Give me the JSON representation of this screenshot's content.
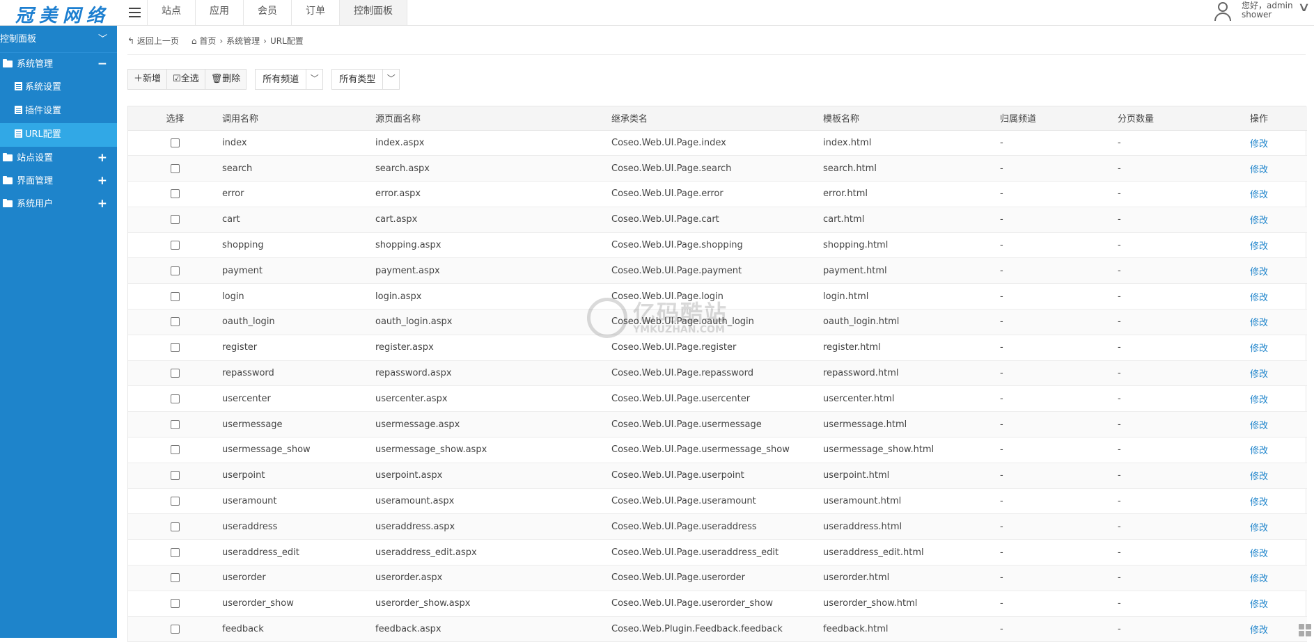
{
  "header": {
    "logo_text": "冠美网络",
    "nav": [
      "站点",
      "应用",
      "会员",
      "订单",
      "控制面板"
    ],
    "active_nav": "控制面板",
    "greeting": "您好，admin",
    "username": "shower"
  },
  "sidebar": {
    "title": "控制面板",
    "groups": [
      {
        "label": "系统管理",
        "toggle": "−",
        "items": [
          "系统设置",
          "插件设置",
          "URL配置"
        ]
      },
      {
        "label": "站点设置",
        "toggle": "+"
      },
      {
        "label": "界面管理",
        "toggle": "+"
      },
      {
        "label": "系统用户",
        "toggle": "+"
      }
    ],
    "active_item": "URL配置"
  },
  "breadcrumb": {
    "back": "返回上一页",
    "home": "首页",
    "level1": "系统管理",
    "current": "URL配置"
  },
  "toolbar": {
    "add_label": "新增",
    "select_all_label": "全选",
    "delete_label": "删除",
    "channel_select": "所有频道",
    "type_select": "所有类型"
  },
  "table": {
    "headers": [
      "选择",
      "调用名称",
      "源页面名称",
      "继承类名",
      "模板名称",
      "归属频道",
      "分页数量",
      "操作"
    ],
    "rows": [
      [
        "index",
        "index.aspx",
        "Coseo.Web.UI.Page.index",
        "index.html",
        "-",
        "-",
        "修改"
      ],
      [
        "search",
        "search.aspx",
        "Coseo.Web.UI.Page.search",
        "search.html",
        "-",
        "-",
        "修改"
      ],
      [
        "error",
        "error.aspx",
        "Coseo.Web.UI.Page.error",
        "error.html",
        "-",
        "-",
        "修改"
      ],
      [
        "cart",
        "cart.aspx",
        "Coseo.Web.UI.Page.cart",
        "cart.html",
        "-",
        "-",
        "修改"
      ],
      [
        "shopping",
        "shopping.aspx",
        "Coseo.Web.UI.Page.shopping",
        "shopping.html",
        "-",
        "-",
        "修改"
      ],
      [
        "payment",
        "payment.aspx",
        "Coseo.Web.UI.Page.payment",
        "payment.html",
        "-",
        "-",
        "修改"
      ],
      [
        "login",
        "login.aspx",
        "Coseo.Web.UI.Page.login",
        "login.html",
        "-",
        "-",
        "修改"
      ],
      [
        "oauth_login",
        "oauth_login.aspx",
        "Coseo.Web.UI.Page.oauth_login",
        "oauth_login.html",
        "-",
        "-",
        "修改"
      ],
      [
        "register",
        "register.aspx",
        "Coseo.Web.UI.Page.register",
        "register.html",
        "-",
        "-",
        "修改"
      ],
      [
        "repassword",
        "repassword.aspx",
        "Coseo.Web.UI.Page.repassword",
        "repassword.html",
        "-",
        "-",
        "修改"
      ],
      [
        "usercenter",
        "usercenter.aspx",
        "Coseo.Web.UI.Page.usercenter",
        "usercenter.html",
        "-",
        "-",
        "修改"
      ],
      [
        "usermessage",
        "usermessage.aspx",
        "Coseo.Web.UI.Page.usermessage",
        "usermessage.html",
        "-",
        "-",
        "修改"
      ],
      [
        "usermessage_show",
        "usermessage_show.aspx",
        "Coseo.Web.UI.Page.usermessage_show",
        "usermessage_show.html",
        "-",
        "-",
        "修改"
      ],
      [
        "userpoint",
        "userpoint.aspx",
        "Coseo.Web.UI.Page.userpoint",
        "userpoint.html",
        "-",
        "-",
        "修改"
      ],
      [
        "useramount",
        "useramount.aspx",
        "Coseo.Web.UI.Page.useramount",
        "useramount.html",
        "-",
        "-",
        "修改"
      ],
      [
        "useraddress",
        "useraddress.aspx",
        "Coseo.Web.UI.Page.useraddress",
        "useraddress.html",
        "-",
        "-",
        "修改"
      ],
      [
        "useraddress_edit",
        "useraddress_edit.aspx",
        "Coseo.Web.UI.Page.useraddress_edit",
        "useraddress_edit.html",
        "-",
        "-",
        "修改"
      ],
      [
        "userorder",
        "userorder.aspx",
        "Coseo.Web.UI.Page.userorder",
        "userorder.html",
        "-",
        "-",
        "修改"
      ],
      [
        "userorder_show",
        "userorder_show.aspx",
        "Coseo.Web.UI.Page.userorder_show",
        "userorder_show.html",
        "-",
        "-",
        "修改"
      ],
      [
        "feedback",
        "feedback.aspx",
        "Coseo.Web.Plugin.Feedback.feedback",
        "feedback.html",
        "-",
        "-",
        "修改"
      ]
    ]
  },
  "watermark": {
    "line1": "亿码酷站",
    "line2": "YMKUZHAN.COM"
  },
  "colors": {
    "sidebar": "#1e84cb",
    "sidebar_active": "#31a8e6",
    "link": "#1e84cb",
    "logo": "#1d7fd0"
  }
}
